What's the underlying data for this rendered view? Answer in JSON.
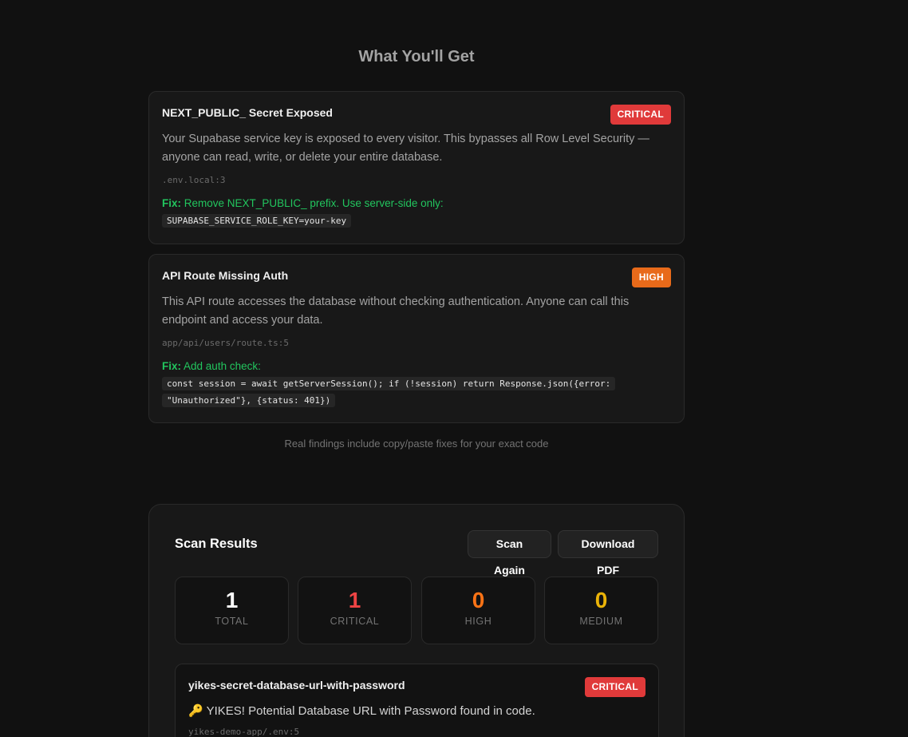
{
  "section": {
    "title": "What You'll Get",
    "note": "Real findings include copy/paste fixes for your exact code"
  },
  "examples": [
    {
      "title": "NEXT_PUBLIC_ Secret Exposed",
      "severity": "CRITICAL",
      "description": "Your Supabase service key is exposed to every visitor. This bypasses all Row Level Security — anyone can read, write, or delete your entire database.",
      "file": ".env.local:3",
      "fix_label": "Fix:",
      "fix_text": "Remove NEXT_PUBLIC_ prefix. Use server-side only:",
      "fix_code": "SUPABASE_SERVICE_ROLE_KEY=your-key"
    },
    {
      "title": "API Route Missing Auth",
      "severity": "HIGH",
      "description": "This API route accesses the database without checking authentication. Anyone can call this endpoint and access your data.",
      "file": "app/api/users/route.ts:5",
      "fix_label": "Fix:",
      "fix_text": "Add auth check:",
      "fix_code": "const session = await getServerSession(); if (!session) return Response.json({error: \"Unauthorized\"}, {status: 401})"
    }
  ],
  "results": {
    "title": "Scan Results",
    "scan_again_label": "Scan Again",
    "download_pdf_label": "Download PDF",
    "stats": {
      "total": {
        "value": "1",
        "label": "TOTAL"
      },
      "critical": {
        "value": "1",
        "label": "CRITICAL"
      },
      "high": {
        "value": "0",
        "label": "HIGH"
      },
      "medium": {
        "value": "0",
        "label": "MEDIUM"
      }
    },
    "findings": [
      {
        "title": "yikes-secret-database-url-with-password",
        "severity": "CRITICAL",
        "icon": "key-icon",
        "description": "🔑 YIKES! Potential Database URL with Password found in code.",
        "file": "yikes-demo-app/.env:5"
      }
    ]
  },
  "colors": {
    "background": "#111111",
    "card": "#181818",
    "critical": "#e03a3a",
    "high": "#e86a1a",
    "medium": "#eab308",
    "fix": "#22c55e"
  }
}
